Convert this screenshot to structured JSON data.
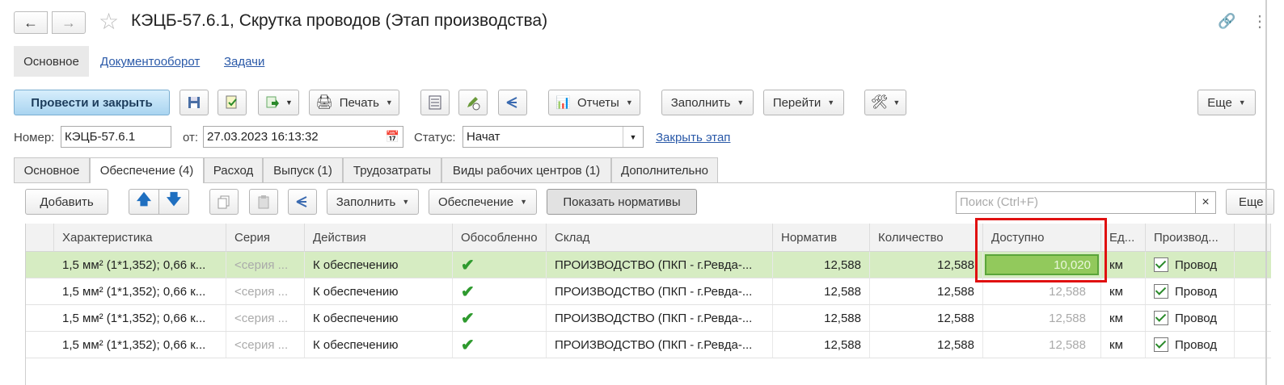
{
  "window": {
    "title": "КЭЦБ-57.6.1, Скрутка проводов (Этап производства)"
  },
  "nav_tabs": {
    "main": "Основное",
    "docflow": "Документооборот",
    "tasks": "Задачи"
  },
  "toolbar": {
    "post_close": "Провести и закрыть",
    "print": "Печать",
    "reports": "Отчеты",
    "fill": "Заполнить",
    "goto": "Перейти",
    "more": "Еще"
  },
  "header_fields": {
    "number_label": "Номер:",
    "number_value": "КЭЦБ-57.6.1",
    "date_label": "от:",
    "date_value": "27.03.2023 16:13:32",
    "status_label": "Статус:",
    "status_value": "Начат",
    "close_stage_link": "Закрыть этап"
  },
  "tabs": [
    {
      "label": "Основное"
    },
    {
      "label": "Обеспечение (4)"
    },
    {
      "label": "Расход"
    },
    {
      "label": "Выпуск (1)"
    },
    {
      "label": "Трудозатраты"
    },
    {
      "label": "Виды рабочих центров (1)"
    },
    {
      "label": "Дополнительно"
    }
  ],
  "table_toolbar": {
    "add": "Добавить",
    "fill": "Заполнить",
    "provision": "Обеспечение",
    "show_norms": "Показать нормативы",
    "search_placeholder": "Поиск (Ctrl+F)",
    "clear": "×",
    "more": "Еще"
  },
  "columns": {
    "characteristic": "Характеристика",
    "series": "Серия",
    "actions": "Действия",
    "separate": "Обособленно",
    "warehouse": "Склад",
    "norm": "Норматив",
    "quantity": "Количество",
    "available": "Доступно",
    "unit": "Ед...",
    "production": "Производ..."
  },
  "rows": [
    {
      "characteristic": "1,5 мм² (1*1,352); 0,66 к...",
      "series": "<серия ...",
      "actions": "К обеспечению",
      "separate": "✔",
      "warehouse": "ПРОИЗВОДСТВО (ПКП - г.Ревда-...",
      "norm": "12,588",
      "quantity": "12,588",
      "available": "10,020",
      "unit": "км",
      "production": "Провод"
    },
    {
      "characteristic": "1,5 мм² (1*1,352); 0,66 к...",
      "series": "<серия ...",
      "actions": "К обеспечению",
      "separate": "✔",
      "warehouse": "ПРОИЗВОДСТВО (ПКП - г.Ревда-...",
      "norm": "12,588",
      "quantity": "12,588",
      "available": "12,588",
      "unit": "км",
      "production": "Провод"
    },
    {
      "characteristic": "1,5 мм² (1*1,352); 0,66 к...",
      "series": "<серия ...",
      "actions": "К обеспечению",
      "separate": "✔",
      "warehouse": "ПРОИЗВОДСТВО (ПКП - г.Ревда-...",
      "norm": "12,588",
      "quantity": "12,588",
      "available": "12,588",
      "unit": "км",
      "production": "Провод"
    },
    {
      "characteristic": "1,5 мм² (1*1,352); 0,66 к...",
      "series": "<серия ...",
      "actions": "К обеспечению",
      "separate": "✔",
      "warehouse": "ПРОИЗВОДСТВО (ПКП - г.Ревда-...",
      "norm": "12,588",
      "quantity": "12,588",
      "available": "12,588",
      "unit": "км",
      "production": "Провод"
    }
  ],
  "colors": {
    "accent_button": "#bfe0f4",
    "selected_row": "#d6ecc2",
    "highlight_box": "#e01010"
  }
}
